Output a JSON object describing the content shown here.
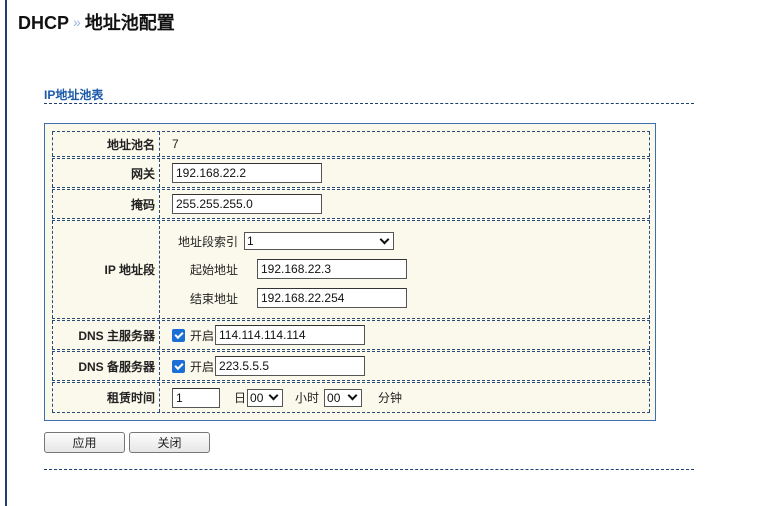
{
  "breadcrumb": {
    "root": "DHCP",
    "separator": "»",
    "current": "地址池配置"
  },
  "section": {
    "title": "IP地址池表"
  },
  "form": {
    "pool_name": {
      "label": "地址池名",
      "value": "7"
    },
    "gateway": {
      "label": "网关",
      "value": "192.168.22.2"
    },
    "mask": {
      "label": "掩码",
      "value": "255.255.255.0"
    },
    "ip_range": {
      "label": "IP 地址段",
      "index_label": "地址段索引",
      "index_value": "1",
      "start_label": "起始地址",
      "start_value": "192.168.22.3",
      "end_label": "结束地址",
      "end_value": "192.168.22.254"
    },
    "dns_primary": {
      "label": "DNS 主服务器",
      "enable_label": "开启",
      "checked": true,
      "value": "114.114.114.114"
    },
    "dns_secondary": {
      "label": "DNS 备服务器",
      "enable_label": "开启",
      "checked": true,
      "value": "223.5.5.5"
    },
    "lease": {
      "label": "租赁时间",
      "days_value": "1",
      "days_unit": "日",
      "hours_value": "00",
      "hours_unit": "小时",
      "minutes_value": "00",
      "minutes_unit": "分钟"
    }
  },
  "buttons": {
    "apply": "应用",
    "close": "关闭"
  },
  "colors": {
    "accent": "#1a5aa8",
    "panel_bg": "#fbf9ec",
    "panel_border": "#3a6fb0",
    "checkbox": "#1a6fd6"
  }
}
